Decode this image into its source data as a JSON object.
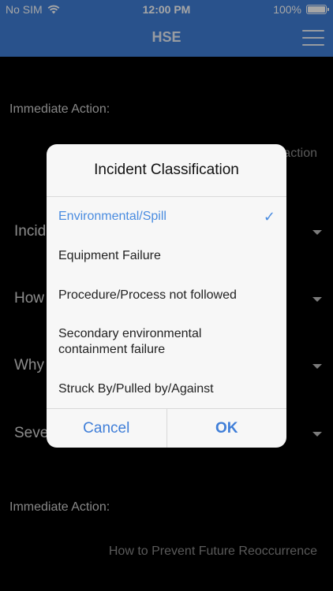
{
  "status_bar": {
    "carrier": "No SIM",
    "time": "12:00 PM",
    "battery": "100%",
    "wifi_icon": "wifi-icon"
  },
  "nav": {
    "title": "HSE",
    "menu_icon": "hamburger-menu-icon"
  },
  "form": {
    "immediate_action_label_1": "Immediate Action:",
    "hint_top": "action",
    "row_incident": "Incid",
    "row_how": "How",
    "row_why": "Why",
    "row_severity": "Seve",
    "immediate_action_label_2": "Immediate Action:",
    "prevent_hint": "How to Prevent Future Reoccurrence"
  },
  "dialog": {
    "title": "Incident Classification",
    "options": [
      {
        "label": "Environmental/Spill",
        "selected": true
      },
      {
        "label": "Equipment Failure",
        "selected": false
      },
      {
        "label": "Procedure/Process not followed",
        "selected": false
      },
      {
        "label": "Secondary environmental containment failure",
        "selected": false
      },
      {
        "label": "Struck By/Pulled by/Against",
        "selected": false
      }
    ],
    "cancel_label": "Cancel",
    "ok_label": "OK",
    "check_glyph": "✓"
  },
  "colors": {
    "accent": "#3f7ed8",
    "selected_text": "#4a8ce0"
  }
}
